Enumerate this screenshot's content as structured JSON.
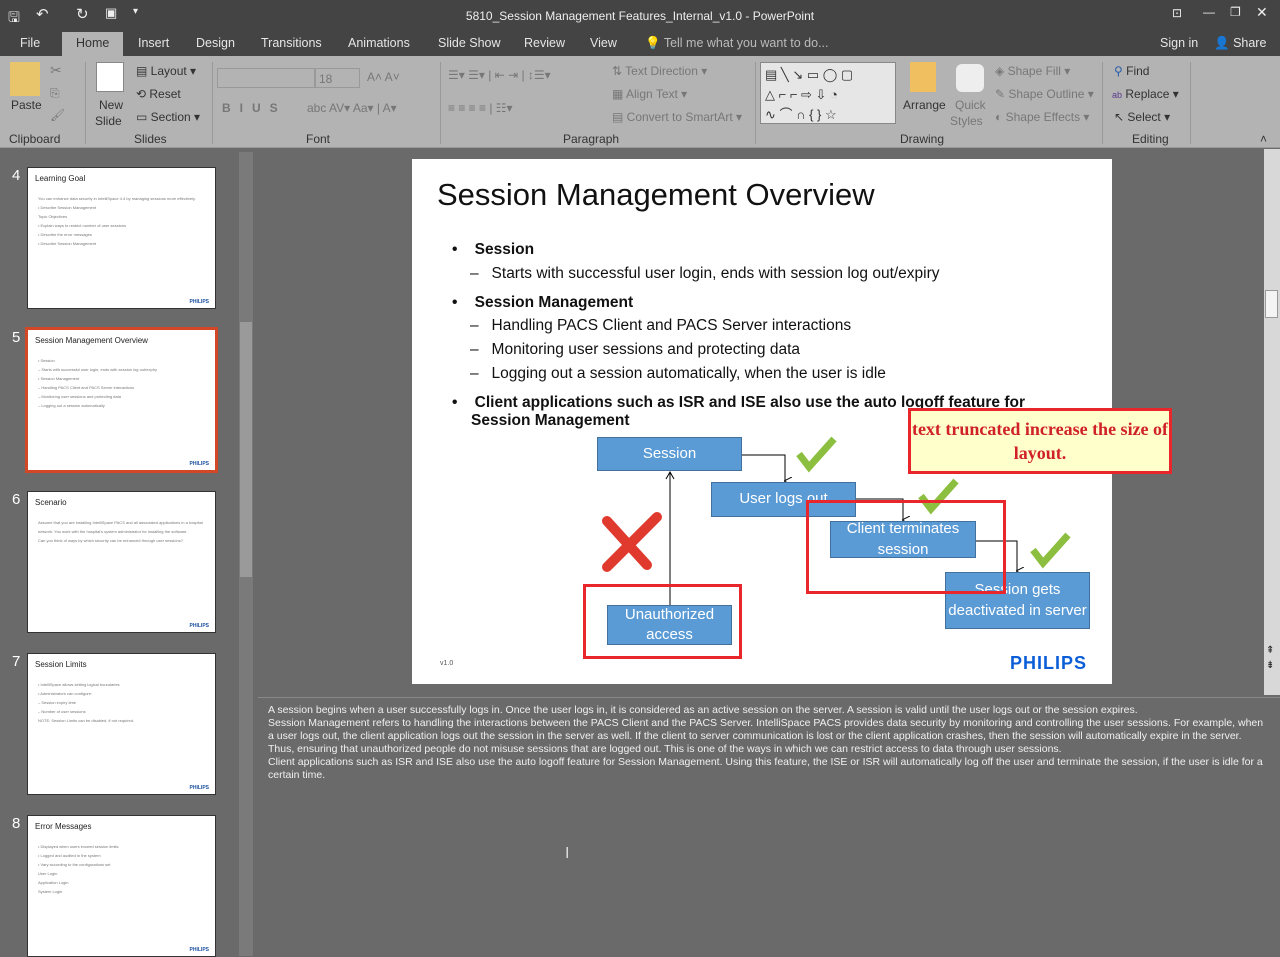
{
  "window": {
    "title": "5810_Session Management Features_Internal_v1.0 - PowerPoint"
  },
  "tabs": [
    "File",
    "Home",
    "Insert",
    "Design",
    "Transitions",
    "Animations",
    "Slide Show",
    "Review",
    "View"
  ],
  "tell_me": "Tell me what you want to do...",
  "sign_in": "Sign in",
  "share": "Share",
  "ribbon": {
    "paste": "Paste",
    "new_slide": "New",
    "new_slide2": "Slide",
    "layout": "Layout",
    "reset": "Reset",
    "section": "Section",
    "font_size": "18",
    "text_direction": "Text Direction",
    "align_text": "Align Text",
    "convert_smartart": "Convert to SmartArt",
    "arrange": "Arrange",
    "quick_styles": "Quick",
    "quick_styles2": "Styles",
    "shape_fill": "Shape Fill",
    "shape_outline": "Shape Outline",
    "shape_effects": "Shape Effects",
    "find": "Find",
    "replace": "Replace",
    "select": "Select",
    "groups": [
      "Clipboard",
      "Slides",
      "Font",
      "Paragraph",
      "Drawing",
      "Editing"
    ]
  },
  "thumbnails": [
    {
      "num": "4",
      "title": "Learning Goal",
      "lines": [
        "You can enhance data security in IntelliSpace 4.4 by managing sessions more effectively.",
        "• Describe Session Management",
        "Topic Objectives",
        "• Explain ways to restrict number of user sessions",
        "• Describe the error messages",
        "• Describe Session Management"
      ]
    },
    {
      "num": "5",
      "title": "Session Management Overview",
      "lines": [
        "• Session",
        "– Starts with successful user login, ends with session log out/expiry",
        "• Session Management",
        "– Handling PACS Client and PACS Server interactions",
        "– Monitoring user sessions and protecting data",
        "– Logging out a session automatically"
      ]
    },
    {
      "num": "6",
      "title": "Scenario",
      "lines": [
        "Assume that you are installing IntelliSpace PACS and all associated applications in a hospital",
        "network. You work with the hospital's system administrator for installing the software.",
        "Can you think of ways by which security can be enhanced through user sessions?"
      ]
    },
    {
      "num": "7",
      "title": "Session Limits",
      "lines": [
        "• IntelliSpace allows setting logical boundaries",
        "• Administrators can configure:",
        "– Session expiry time",
        "– Number of user sessions",
        "NOTE: Session Limits can be disabled, if not required."
      ]
    },
    {
      "num": "8",
      "title": "Error Messages",
      "lines": [
        "• Displayed when users exceed session limits",
        "• Logged and audited in the system",
        "• Vary according to the configurations set",
        "User Login",
        "Application Login",
        "System Login"
      ]
    }
  ],
  "slide": {
    "title": "Session Management Overview",
    "b1": "Session",
    "b1s": "Starts with successful user login, ends with session log out/expiry",
    "b2": "Session Management",
    "b2s": [
      "Handling PACS Client and PACS Server interactions",
      "Monitoring user sessions and protecting data",
      "Logging out a session automatically, when the user is idle"
    ],
    "b3": "Client applications such as ISR and ISE also use the auto logoff feature for",
    "b3b": "Session Management",
    "boxes": {
      "session": "Session",
      "logout": "User logs out",
      "client": "Client terminates session",
      "deact": "Session gets deactivated in server",
      "unauth": "Unauthorized access"
    },
    "callout": "text truncated increase the size of layout.",
    "version": "v1.0",
    "logo": "PHILIPS"
  },
  "notes": [
    "A session begins when a user successfully logs in. Once the user logs in, it is considered as an active session on the server. A session is valid until the user logs out or the session expires.",
    "Session Management refers to handling the interactions between the PACS Client and the PACS Server. IntelliSpace PACS provides data security by monitoring and controlling the user sessions. For example, when a user logs out, the client application logs out the session in the server as well. If the client to server communication is lost or the client application crashes, then the session will automatically expire in the server. Thus, ensuring that unauthorized people do not misuse sessions that are logged out. This is one of the ways in which we can restrict access to data through user sessions.",
    "Client applications such as ISR and ISE also use the auto logoff feature for Session Management. Using this feature, the ISE or ISR will automatically log off the user and terminate the session, if the user is idle for a certain time."
  ]
}
